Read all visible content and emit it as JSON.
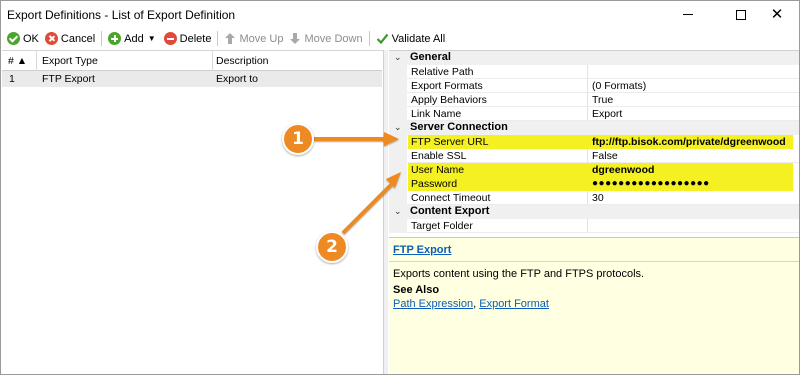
{
  "window": {
    "title": "Export Definitions - List of Export Definition"
  },
  "toolbar": {
    "ok_label": "OK",
    "cancel_label": "Cancel",
    "add_label": "Add",
    "delete_label": "Delete",
    "move_up_label": "Move Up",
    "move_down_label": "Move Down",
    "validate_all_label": "Validate All"
  },
  "grid": {
    "columns": [
      "# ▲",
      "Export Type",
      "Description"
    ],
    "rows": [
      {
        "index": "1",
        "export_type": "FTP Export",
        "description": "Export to"
      }
    ]
  },
  "properties": {
    "categories": [
      {
        "name": "General",
        "items": [
          {
            "name": "Relative Path",
            "value": ""
          },
          {
            "name": "Export Formats",
            "value": "(0 Formats)"
          },
          {
            "name": "Apply Behaviors",
            "value": "True"
          },
          {
            "name": "Link Name",
            "value": "Export"
          }
        ]
      },
      {
        "name": "Server Connection",
        "items": [
          {
            "name": "FTP Server URL",
            "value": "ftp://ftp.bisok.com/private/dgreenwood",
            "highlight": true
          },
          {
            "name": "Enable SSL",
            "value": "False"
          },
          {
            "name": "User Name",
            "value": "dgreenwood",
            "highlight": true
          },
          {
            "name": "Password",
            "value": "●●●●●●●●●●●●●●●●●●",
            "highlight": true
          },
          {
            "name": "Connect Timeout",
            "value": "30"
          }
        ]
      },
      {
        "name": "Content Export",
        "items": [
          {
            "name": "Target Folder",
            "value": ""
          }
        ]
      }
    ]
  },
  "description": {
    "title": "FTP Export",
    "text": "Exports content using the FTP and FTPS protocols.",
    "see_also": "See Also",
    "link1": "Path Expression",
    "separator": ", ",
    "link2": "Export Format"
  },
  "callouts": {
    "one": "1",
    "two": "2",
    "color": "#ee8a23"
  },
  "colors": {
    "highlight": "#f5f022",
    "link": "#0b5db8",
    "description_bg": "#ffffe1"
  }
}
